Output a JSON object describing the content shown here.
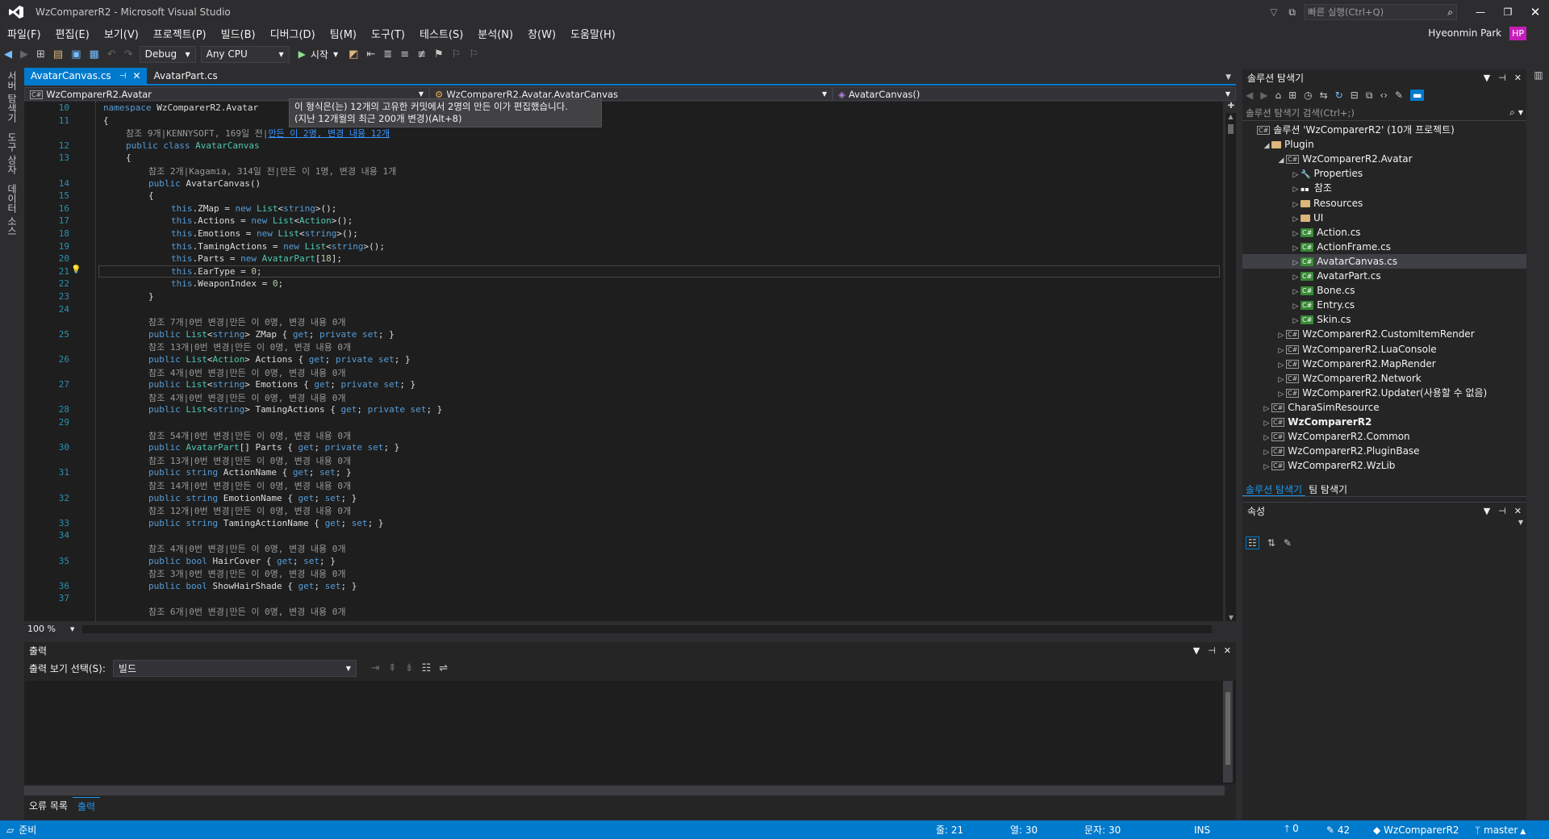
{
  "window": {
    "title": "WzComparerR2 - Microsoft Visual Studio",
    "quick_launch_placeholder": "빠른 실행(Ctrl+Q)",
    "user": "Hyeonmin Park",
    "user_initials": "HP"
  },
  "menu": [
    "파일(F)",
    "편집(E)",
    "보기(V)",
    "프로젝트(P)",
    "빌드(B)",
    "디버그(D)",
    "팀(M)",
    "도구(T)",
    "테스트(S)",
    "분석(N)",
    "창(W)",
    "도움말(H)"
  ],
  "toolbar": {
    "config": "Debug",
    "platform": "Any CPU",
    "start": "시작"
  },
  "vertical_tabs": [
    "서버 탐색기",
    "도구 상자",
    "데이터 소스"
  ],
  "editor": {
    "tabs": [
      {
        "label": "AvatarCanvas.cs",
        "active": true
      },
      {
        "label": "AvatarPart.cs",
        "active": false
      }
    ],
    "nav": {
      "project": "WzComparerR2.Avatar",
      "type": "WzComparerR2.Avatar.AvatarCanvas",
      "member": "AvatarCanvas()"
    },
    "tooltip": {
      "line1": "이 형식은(는) 12개의 고유한 커밋에서 2명의 만든 이가 편집했습니다.",
      "line2": "(지난 12개월의 최근 200개 변경)(Alt+8)"
    },
    "zoom": "100 %",
    "lines": [
      {
        "n": "10",
        "indent": 0,
        "parts": [
          [
            "kw",
            "namespace"
          ],
          [
            "tx",
            " WzComparerR2.Avatar"
          ]
        ]
      },
      {
        "n": "11",
        "indent": 0,
        "parts": [
          [
            "tx",
            "{"
          ]
        ]
      },
      {
        "lens": "참조 9개|KENNYSOFT, 169일 전|",
        "lens_link": "만든 이 2명, 변경 내용 12개",
        "lens_indent": 1
      },
      {
        "n": "12",
        "indent": 1,
        "parts": [
          [
            "kw",
            "public class "
          ],
          [
            "ty",
            "AvatarCanvas"
          ]
        ]
      },
      {
        "n": "13",
        "indent": 1,
        "parts": [
          [
            "tx",
            "{"
          ]
        ]
      },
      {
        "lens": "참조 2개|Kagamia, 314일 전|만든 이 1명, 변경 내용 1개",
        "lens_indent": 2
      },
      {
        "n": "14",
        "indent": 2,
        "parts": [
          [
            "kw",
            "public "
          ],
          [
            "tx",
            "AvatarCanvas()"
          ]
        ]
      },
      {
        "n": "15",
        "indent": 2,
        "parts": [
          [
            "tx",
            "{"
          ]
        ]
      },
      {
        "n": "16",
        "indent": 3,
        "parts": [
          [
            "kw",
            "this"
          ],
          [
            "tx",
            ".ZMap = "
          ],
          [
            "kw",
            "new "
          ],
          [
            "ty",
            "List"
          ],
          [
            "tx",
            "<"
          ],
          [
            "kw",
            "string"
          ],
          [
            "tx",
            ">();"
          ]
        ]
      },
      {
        "n": "17",
        "indent": 3,
        "parts": [
          [
            "kw",
            "this"
          ],
          [
            "tx",
            ".Actions = "
          ],
          [
            "kw",
            "new "
          ],
          [
            "ty",
            "List"
          ],
          [
            "tx",
            "<"
          ],
          [
            "ty",
            "Action"
          ],
          [
            "tx",
            ">();"
          ]
        ]
      },
      {
        "n": "18",
        "indent": 3,
        "parts": [
          [
            "kw",
            "this"
          ],
          [
            "tx",
            ".Emotions = "
          ],
          [
            "kw",
            "new "
          ],
          [
            "ty",
            "List"
          ],
          [
            "tx",
            "<"
          ],
          [
            "kw",
            "string"
          ],
          [
            "tx",
            ">();"
          ]
        ]
      },
      {
        "n": "19",
        "indent": 3,
        "parts": [
          [
            "kw",
            "this"
          ],
          [
            "tx",
            ".TamingActions = "
          ],
          [
            "kw",
            "new "
          ],
          [
            "ty",
            "List"
          ],
          [
            "tx",
            "<"
          ],
          [
            "kw",
            "string"
          ],
          [
            "tx",
            ">();"
          ]
        ]
      },
      {
        "n": "20",
        "indent": 3,
        "parts": [
          [
            "kw",
            "this"
          ],
          [
            "tx",
            ".Parts = "
          ],
          [
            "kw",
            "new "
          ],
          [
            "ty",
            "AvatarPart"
          ],
          [
            "tx",
            "["
          ],
          [
            "num",
            "18"
          ],
          [
            "tx",
            "];"
          ]
        ]
      },
      {
        "n": "21",
        "indent": 3,
        "current": true,
        "parts": [
          [
            "kw",
            "this"
          ],
          [
            "tx",
            ".EarType = "
          ],
          [
            "num",
            "0"
          ],
          [
            "tx",
            ";"
          ]
        ]
      },
      {
        "n": "22",
        "indent": 3,
        "parts": [
          [
            "kw",
            "this"
          ],
          [
            "tx",
            ".WeaponIndex = "
          ],
          [
            "num",
            "0"
          ],
          [
            "tx",
            ";"
          ]
        ]
      },
      {
        "n": "23",
        "indent": 2,
        "parts": [
          [
            "tx",
            "}"
          ]
        ]
      },
      {
        "n": "24",
        "indent": 0,
        "parts": []
      },
      {
        "lens": "참조 7개|0번 변경|만든 이 0명, 변경 내용 0개",
        "lens_indent": 2
      },
      {
        "n": "25",
        "indent": 2,
        "parts": [
          [
            "kw",
            "public "
          ],
          [
            "ty",
            "List"
          ],
          [
            "tx",
            "<"
          ],
          [
            "kw",
            "string"
          ],
          [
            "tx",
            "> ZMap { "
          ],
          [
            "kw",
            "get"
          ],
          [
            "tx",
            "; "
          ],
          [
            "kw",
            "private set"
          ],
          [
            "tx",
            "; }"
          ]
        ]
      },
      {
        "lens": "참조 13개|0번 변경|만든 이 0명, 변경 내용 0개",
        "lens_indent": 2
      },
      {
        "n": "26",
        "indent": 2,
        "parts": [
          [
            "kw",
            "public "
          ],
          [
            "ty",
            "List"
          ],
          [
            "tx",
            "<"
          ],
          [
            "ty",
            "Action"
          ],
          [
            "tx",
            "> Actions { "
          ],
          [
            "kw",
            "get"
          ],
          [
            "tx",
            "; "
          ],
          [
            "kw",
            "private set"
          ],
          [
            "tx",
            "; }"
          ]
        ]
      },
      {
        "lens": "참조 4개|0번 변경|만든 이 0명, 변경 내용 0개",
        "lens_indent": 2
      },
      {
        "n": "27",
        "indent": 2,
        "parts": [
          [
            "kw",
            "public "
          ],
          [
            "ty",
            "List"
          ],
          [
            "tx",
            "<"
          ],
          [
            "kw",
            "string"
          ],
          [
            "tx",
            "> Emotions { "
          ],
          [
            "kw",
            "get"
          ],
          [
            "tx",
            "; "
          ],
          [
            "kw",
            "private set"
          ],
          [
            "tx",
            "; }"
          ]
        ]
      },
      {
        "lens": "참조 4개|0번 변경|만든 이 0명, 변경 내용 0개",
        "lens_indent": 2
      },
      {
        "n": "28",
        "indent": 2,
        "parts": [
          [
            "kw",
            "public "
          ],
          [
            "ty",
            "List"
          ],
          [
            "tx",
            "<"
          ],
          [
            "kw",
            "string"
          ],
          [
            "tx",
            "> TamingActions { "
          ],
          [
            "kw",
            "get"
          ],
          [
            "tx",
            "; "
          ],
          [
            "kw",
            "private set"
          ],
          [
            "tx",
            "; }"
          ]
        ]
      },
      {
        "n": "29",
        "indent": 0,
        "parts": []
      },
      {
        "lens": "참조 54개|0번 변경|만든 이 0명, 변경 내용 0개",
        "lens_indent": 2
      },
      {
        "n": "30",
        "indent": 2,
        "parts": [
          [
            "kw",
            "public "
          ],
          [
            "ty",
            "AvatarPart"
          ],
          [
            "tx",
            "[] Parts { "
          ],
          [
            "kw",
            "get"
          ],
          [
            "tx",
            "; "
          ],
          [
            "kw",
            "private set"
          ],
          [
            "tx",
            "; }"
          ]
        ]
      },
      {
        "lens": "참조 13개|0번 변경|만든 이 0명, 변경 내용 0개",
        "lens_indent": 2
      },
      {
        "n": "31",
        "indent": 2,
        "parts": [
          [
            "kw",
            "public string "
          ],
          [
            "tx",
            "ActionName { "
          ],
          [
            "kw",
            "get"
          ],
          [
            "tx",
            "; "
          ],
          [
            "kw",
            "set"
          ],
          [
            "tx",
            "; }"
          ]
        ]
      },
      {
        "lens": "참조 14개|0번 변경|만든 이 0명, 변경 내용 0개",
        "lens_indent": 2
      },
      {
        "n": "32",
        "indent": 2,
        "parts": [
          [
            "kw",
            "public string "
          ],
          [
            "tx",
            "EmotionName { "
          ],
          [
            "kw",
            "get"
          ],
          [
            "tx",
            "; "
          ],
          [
            "kw",
            "set"
          ],
          [
            "tx",
            "; }"
          ]
        ]
      },
      {
        "lens": "참조 12개|0번 변경|만든 이 0명, 변경 내용 0개",
        "lens_indent": 2
      },
      {
        "n": "33",
        "indent": 2,
        "parts": [
          [
            "kw",
            "public string "
          ],
          [
            "tx",
            "TamingActionName { "
          ],
          [
            "kw",
            "get"
          ],
          [
            "tx",
            "; "
          ],
          [
            "kw",
            "set"
          ],
          [
            "tx",
            "; }"
          ]
        ]
      },
      {
        "n": "34",
        "indent": 0,
        "parts": []
      },
      {
        "lens": "참조 4개|0번 변경|만든 이 0명, 변경 내용 0개",
        "lens_indent": 2
      },
      {
        "n": "35",
        "indent": 2,
        "parts": [
          [
            "kw",
            "public bool "
          ],
          [
            "tx",
            "HairCover { "
          ],
          [
            "kw",
            "get"
          ],
          [
            "tx",
            "; "
          ],
          [
            "kw",
            "set"
          ],
          [
            "tx",
            "; }"
          ]
        ]
      },
      {
        "lens": "참조 3개|0번 변경|만든 이 0명, 변경 내용 0개",
        "lens_indent": 2
      },
      {
        "n": "36",
        "indent": 2,
        "parts": [
          [
            "kw",
            "public bool "
          ],
          [
            "tx",
            "ShowHairShade { "
          ],
          [
            "kw",
            "get"
          ],
          [
            "tx",
            "; "
          ],
          [
            "kw",
            "set"
          ],
          [
            "tx",
            "; }"
          ]
        ]
      },
      {
        "n": "37",
        "indent": 0,
        "parts": []
      },
      {
        "lens": "참조 6개|0번 변경|만든 이 0명, 변경 내용 0개",
        "lens_indent": 2
      }
    ]
  },
  "output": {
    "title": "출력",
    "source_label": "출력 보기 선택(S):",
    "source_value": "빌드",
    "tabs": [
      "오류 목록",
      "출력"
    ]
  },
  "solution_explorer": {
    "title": "솔루션 탐색기",
    "search_placeholder": "솔루션 탐색기 검색(Ctrl+;)",
    "items": [
      {
        "label": "솔루션 'WzComparerR2' (10개 프로젝트)",
        "level": 0,
        "kind": "solution",
        "tw": ""
      },
      {
        "label": "Plugin",
        "level": 1,
        "kind": "folder",
        "tw": "◢"
      },
      {
        "label": "WzComparerR2.Avatar",
        "level": 2,
        "kind": "project",
        "tw": "◢"
      },
      {
        "label": "Properties",
        "level": 3,
        "kind": "wrench",
        "tw": "▷"
      },
      {
        "label": "참조",
        "level": 3,
        "kind": "ref",
        "tw": "▷"
      },
      {
        "label": "Resources",
        "level": 3,
        "kind": "folder",
        "tw": "▷"
      },
      {
        "label": "UI",
        "level": 3,
        "kind": "folder",
        "tw": "▷"
      },
      {
        "label": "Action.cs",
        "level": 3,
        "kind": "cs",
        "tw": "▷"
      },
      {
        "label": "ActionFrame.cs",
        "level": 3,
        "kind": "cs",
        "tw": "▷"
      },
      {
        "label": "AvatarCanvas.cs",
        "level": 3,
        "kind": "cs",
        "tw": "▷",
        "selected": true
      },
      {
        "label": "AvatarPart.cs",
        "level": 3,
        "kind": "cs",
        "tw": "▷"
      },
      {
        "label": "Bone.cs",
        "level": 3,
        "kind": "cs",
        "tw": "▷"
      },
      {
        "label": "Entry.cs",
        "level": 3,
        "kind": "cs",
        "tw": "▷"
      },
      {
        "label": "Skin.cs",
        "level": 3,
        "kind": "cs",
        "tw": "▷"
      },
      {
        "label": "WzComparerR2.CustomItemRender",
        "level": 2,
        "kind": "project",
        "tw": "▷"
      },
      {
        "label": "WzComparerR2.LuaConsole",
        "level": 2,
        "kind": "project",
        "tw": "▷"
      },
      {
        "label": "WzComparerR2.MapRender",
        "level": 2,
        "kind": "project",
        "tw": "▷"
      },
      {
        "label": "WzComparerR2.Network",
        "level": 2,
        "kind": "project",
        "tw": "▷"
      },
      {
        "label": "WzComparerR2.Updater(사용할 수 없음)",
        "level": 2,
        "kind": "project",
        "tw": "▷"
      },
      {
        "label": "CharaSimResource",
        "level": 1,
        "kind": "project",
        "tw": "▷"
      },
      {
        "label": "WzComparerR2",
        "level": 1,
        "kind": "project",
        "tw": "▷",
        "bold": true
      },
      {
        "label": "WzComparerR2.Common",
        "level": 1,
        "kind": "project",
        "tw": "▷"
      },
      {
        "label": "WzComparerR2.PluginBase",
        "level": 1,
        "kind": "project",
        "tw": "▷"
      },
      {
        "label": "WzComparerR2.WzLib",
        "level": 1,
        "kind": "project",
        "tw": "▷"
      }
    ],
    "bottom_tabs": [
      "솔루션 탐색기",
      "팀 탐색기"
    ]
  },
  "properties": {
    "title": "속성"
  },
  "status": {
    "ready": "준비",
    "line": "줄: 21",
    "col": "열: 30",
    "ch": "문자: 30",
    "ins": "INS",
    "up": "0",
    "edits": "42",
    "repo": "WzComparerR2",
    "branch": "master"
  },
  "colors": {
    "accent": "#007acc",
    "keyword": "#569cd6",
    "type": "#4ec9b0",
    "linenum": "#2b91af"
  }
}
